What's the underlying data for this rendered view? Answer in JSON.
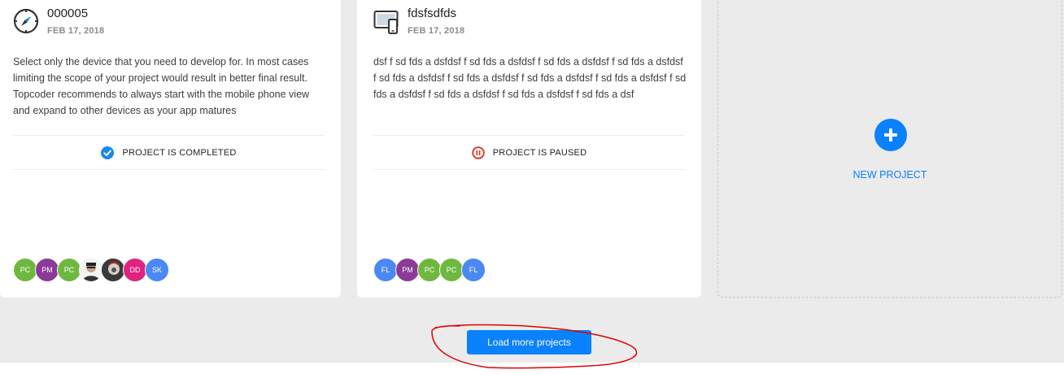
{
  "projects": [
    {
      "icon": "compass-icon",
      "title": "000005",
      "date": "FEB 17, 2018",
      "description": "Select only the device that you need to develop for. In most cases limiting the scope of your project would result in better final result. Topcoder recommends to always start with the mobile phone view and expand to other devices as your app matures",
      "status": "PROJECT IS COMPLETED",
      "status_icon": "check-circle-icon",
      "members": [
        {
          "initials": "PC",
          "color": "#6fb840"
        },
        {
          "initials": "PM",
          "color": "#8b3a98"
        },
        {
          "initials": "PC",
          "color": "#6fb840"
        },
        {
          "initials": "",
          "photo": "person-photo-1"
        },
        {
          "initials": "",
          "photo": "person-photo-2"
        },
        {
          "initials": "DD",
          "color": "#e0237e"
        },
        {
          "initials": "SK",
          "color": "#4a89f3"
        }
      ]
    },
    {
      "icon": "devices-icon",
      "title": "fdsfsdfds",
      "date": "FEB 17, 2018",
      "description": "dsf f sd fds a dsfdsf f sd fds a dsfdsf f sd fds a dsfdsf f sd fds a dsfdsf f sd fds a dsfdsf f sd fds a dsfdsf f sd fds a dsfdsf f sd fds a dsfdsf f sd fds a dsfdsf f sd fds a dsfdsf f sd fds a dsfdsf f sd fds a dsf",
      "status": "PROJECT IS PAUSED",
      "status_icon": "pause-circle-icon",
      "members": [
        {
          "initials": "FL",
          "color": "#4a89f3"
        },
        {
          "initials": "PM",
          "color": "#8b3a98"
        },
        {
          "initials": "PC",
          "color": "#6fb840"
        },
        {
          "initials": "PC",
          "color": "#6fb840"
        },
        {
          "initials": "FL",
          "color": "#4a89f3"
        }
      ]
    }
  ],
  "new_project": {
    "label": "NEW PROJECT",
    "icon": "plus-icon"
  },
  "load_more": {
    "label": "Load more projects"
  },
  "colors": {
    "accent": "#0a81ff",
    "completed": "#1e88e5",
    "paused": "#e0301e",
    "background": "#ebebeb",
    "annotation": "#e00000"
  }
}
